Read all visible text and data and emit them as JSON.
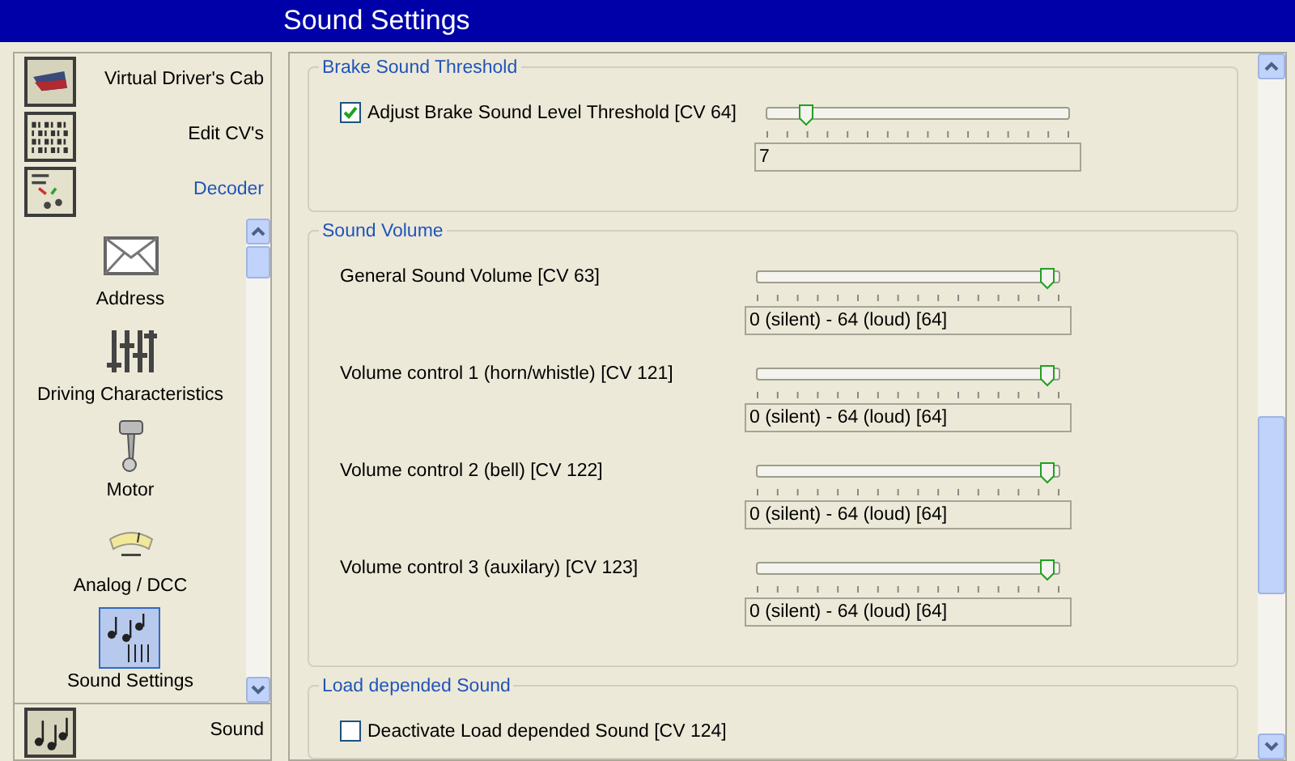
{
  "window": {
    "title": "Sound Settings"
  },
  "sidebar": {
    "headers_top": [
      {
        "label": "Virtual Driver's Cab",
        "selected": false,
        "kind": "cab"
      },
      {
        "label": "Edit CV's",
        "selected": false,
        "kind": "binary"
      },
      {
        "label": "Decoder",
        "selected": true,
        "kind": "decoder"
      }
    ],
    "items": [
      {
        "label": "Address",
        "selected": false,
        "kind": "envelope"
      },
      {
        "label": "Driving Characteristics",
        "selected": false,
        "kind": "sliders"
      },
      {
        "label": "Motor",
        "selected": false,
        "kind": "piston"
      },
      {
        "label": "Analog / DCC",
        "selected": false,
        "kind": "gauge"
      },
      {
        "label": "Sound Settings",
        "selected": true,
        "kind": "notes-sliders"
      }
    ],
    "headers_bottom": [
      {
        "label": "Sound",
        "selected": false,
        "kind": "notes"
      }
    ]
  },
  "groups": [
    {
      "title": "Brake Sound Threshold",
      "rows": [
        {
          "kind": "checkbox_slider",
          "label": "Adjust Brake Sound Level Threshold [CV 64]",
          "checked": true,
          "level": 0.11,
          "value": "7"
        }
      ]
    },
    {
      "title": "Sound Volume",
      "rows": [
        {
          "kind": "slider",
          "label": "General Sound Volume [CV 63]",
          "level": 1,
          "value": "0 (silent) - 64 (loud)  [64]"
        },
        {
          "kind": "slider",
          "label": "Volume control 1 (horn/whistle) [CV 121]",
          "level": 1,
          "value": "0 (silent) - 64 (loud)  [64]"
        },
        {
          "kind": "slider",
          "label": "Volume control 2 (bell) [CV 122]",
          "level": 1,
          "value": "0 (silent) - 64 (loud)  [64]"
        },
        {
          "kind": "slider",
          "label": "Volume control 3 (auxilary) [CV 123]",
          "level": 1,
          "value": "0 (silent) - 64 (loud)  [64]"
        }
      ]
    },
    {
      "title": "Load depended Sound",
      "rows": [
        {
          "kind": "checkbox",
          "label": "Deactivate Load depended Sound [CV 124]",
          "checked": false
        }
      ]
    }
  ]
}
